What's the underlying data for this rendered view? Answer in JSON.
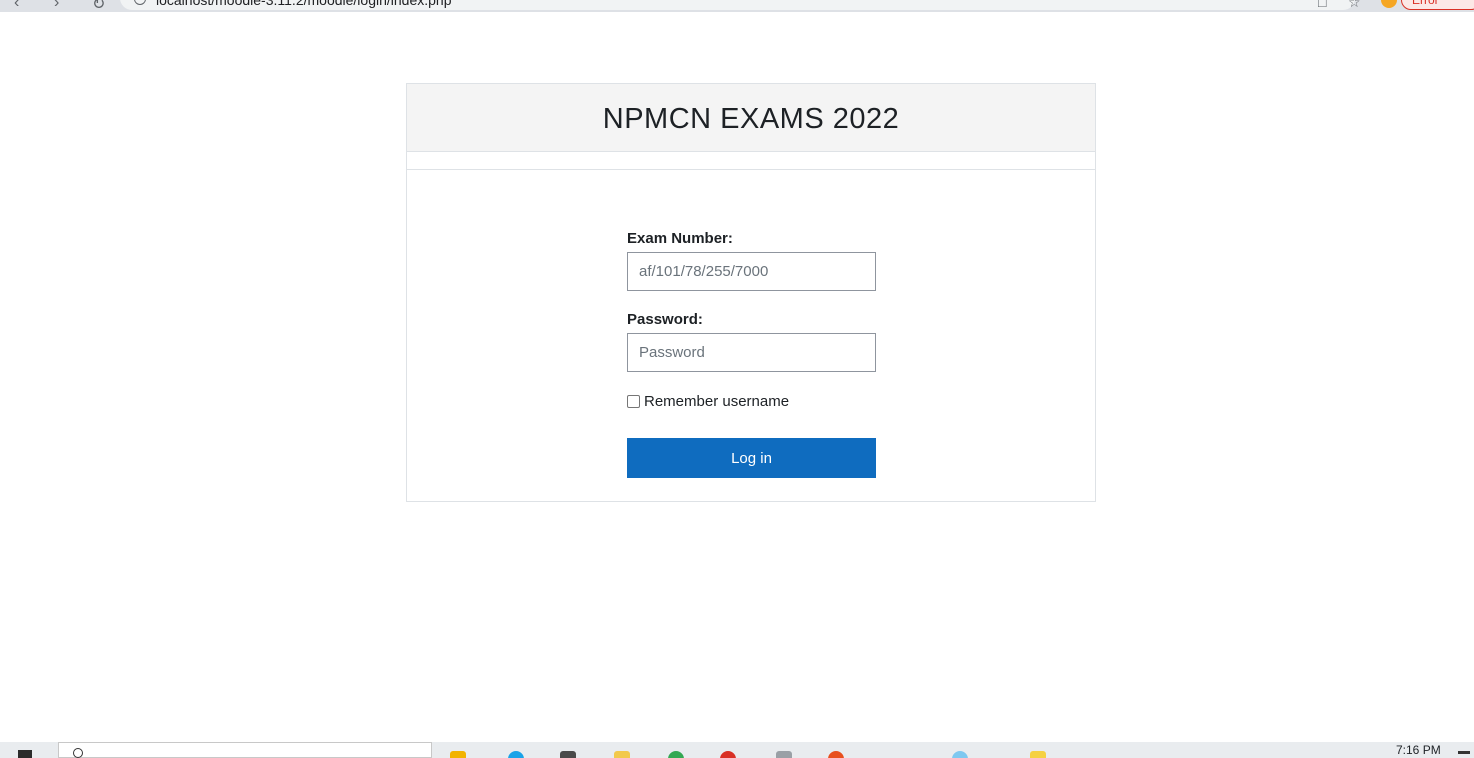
{
  "browser": {
    "url": "localhost/moodle-3.11.2/moodle/login/index.php",
    "error_label": "Error"
  },
  "card": {
    "title": "NPMCN EXAMS 2022"
  },
  "form": {
    "username_label": "Exam Number:",
    "username_placeholder": "af/101/78/255/7000",
    "password_label": "Password:",
    "password_placeholder": "Password",
    "remember_label": "Remember username",
    "login_button": "Log in"
  },
  "taskbar": {
    "clock": "7:16 PM"
  },
  "colors": {
    "primary_button": "#0f6cbf",
    "header_bg": "#f4f4f4"
  }
}
